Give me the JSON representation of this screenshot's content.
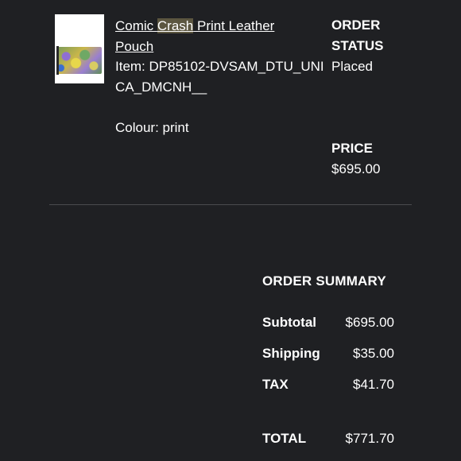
{
  "item": {
    "title_parts": [
      "Comic ",
      "Crash",
      " Print Leather Pouch"
    ],
    "item_line": "Item: DP85102-DVSAM_DTU_UNICA_DMCNH__",
    "colour_line": "Colour: print"
  },
  "status": {
    "heading": "ORDER STATUS",
    "value": "Placed"
  },
  "price": {
    "heading": "PRICE",
    "value": "$695.00"
  },
  "summary": {
    "title": "ORDER SUMMARY",
    "rows": [
      {
        "label": "Subtotal",
        "value": "$695.00"
      },
      {
        "label": "Shipping",
        "value": "$35.00"
      },
      {
        "label": "TAX",
        "value": "$41.70"
      },
      {
        "label": "TOTAL",
        "value": "$771.70"
      }
    ]
  },
  "colors": {
    "background": "#1f2023",
    "text": "#ffffff",
    "highlight": "#5c5640",
    "divider": "#4a4b4e"
  }
}
